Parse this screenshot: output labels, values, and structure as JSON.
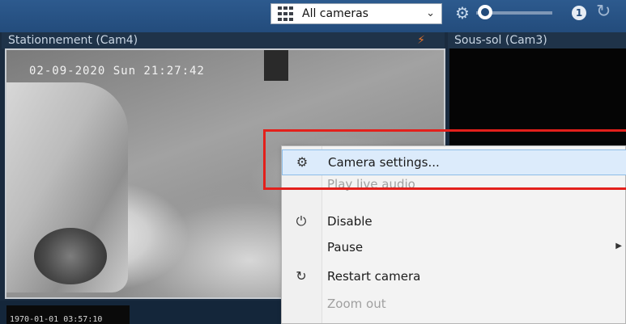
{
  "toolbar": {
    "camera_selector": {
      "value": "All cameras",
      "icon": "grid-icon"
    },
    "settings_icon": "gear-icon",
    "one_badge": "1",
    "refresh_icon": "refresh-icon"
  },
  "cameras": [
    {
      "title": "Stationnement (Cam4)",
      "timestamp": "02-09-2020 Sun 21:27:42",
      "alert_icon": "bolt-icon"
    },
    {
      "title": "Sous-sol (Cam3)"
    }
  ],
  "bottom_tile": {
    "timestamp": "1970-01-01 03:57:10"
  },
  "context_menu": {
    "items": [
      {
        "label": "Camera settings...",
        "icon": "gear-icon",
        "highlighted": true
      },
      {
        "label": "Play live audio",
        "disabled": true
      },
      {
        "label": "Disable",
        "icon": "power-icon"
      },
      {
        "label": "Pause",
        "submenu": true
      },
      {
        "label": "Restart camera",
        "icon": "refresh-icon"
      },
      {
        "label": "Zoom out",
        "disabled": true
      }
    ]
  },
  "colors": {
    "toolbar": "#234c7c",
    "highlight": "#dcebfb",
    "annotation": "#e3201b",
    "alert": "#e8742a"
  }
}
